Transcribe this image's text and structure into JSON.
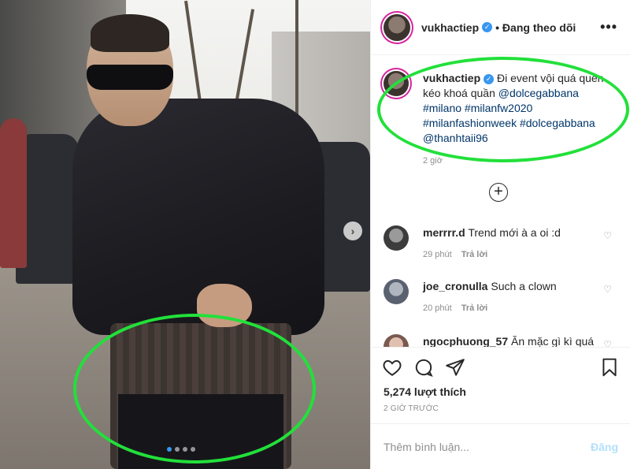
{
  "post": {
    "username": "vukhactiep",
    "follow_status": "• Đang theo dõi",
    "more_label": "•••",
    "caption": {
      "text": "Đi event vội quá quên kéo khoá quần",
      "mention1": "@dolcegabbana",
      "hashtags1": "#milano #milanfw2020",
      "hashtags2": "#milanfashionweek #dolcegabbana",
      "mention2": "@thanhtaii96",
      "time": "2 giờ"
    },
    "load_more_label": "+",
    "likes": "5,274 lượt thích",
    "post_time": "2 GIỜ TRƯỚC",
    "add_comment_placeholder": "Thêm bình luận...",
    "post_button": "Đăng",
    "reply_label": "Trả lời"
  },
  "comments": [
    {
      "username": "merrrr.d",
      "text": "Trend mới à a oi :d",
      "time": "29 phút"
    },
    {
      "username": "joe_cronulla",
      "text": "Such a clown",
      "time": "20 phút"
    },
    {
      "username": "ngocphuong_57",
      "text": "Ăn mặc gì kì quá",
      "time": ""
    }
  ],
  "colors": {
    "annotation": "#22e03a",
    "verified": "#3897f0",
    "link": "#003569",
    "post_button": "#b2dffc"
  },
  "icons": [
    "verified-badge-icon",
    "more-options-icon",
    "load-more-icon",
    "heart-icon",
    "comment-icon",
    "share-icon",
    "bookmark-icon",
    "next-arrow-icon"
  ]
}
